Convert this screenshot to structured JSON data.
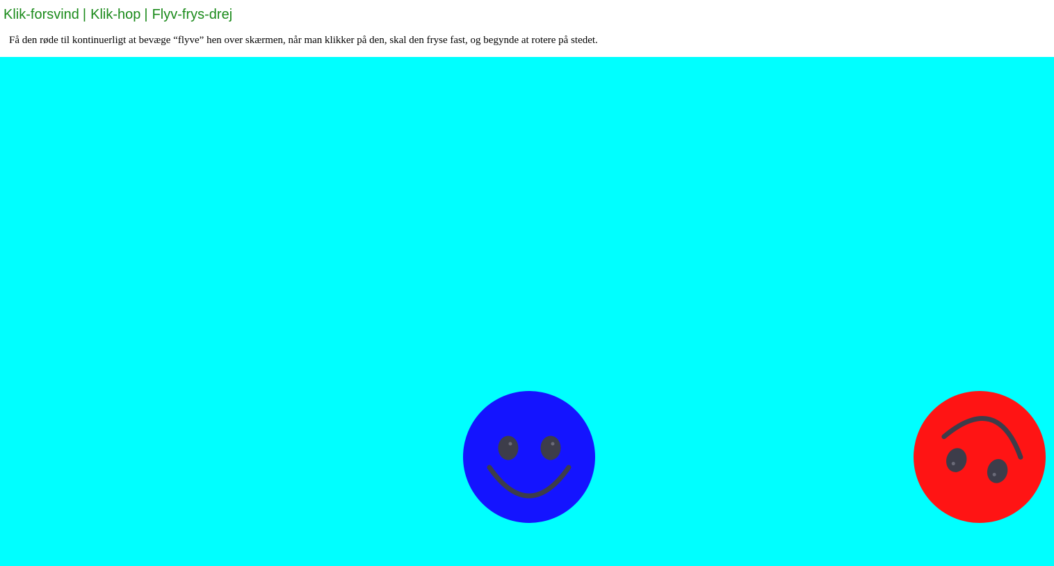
{
  "nav": {
    "links": [
      "Klik-forsvind",
      "Klik-hop",
      "Flyv-frys-drej"
    ],
    "separator": "|"
  },
  "description": "Få den røde til kontinuerligt at bevæge “flyve” hen over skærmen, når man klikker på den, skal den fryse fast, og begynde at rotere på stedet.",
  "colors": {
    "stage_background": "#00ffff",
    "nav_link": "#1a8a1a",
    "blue_smiley": "#1414ff",
    "red_smiley": "#ff1414",
    "smiley_features": "#3d3d4a"
  },
  "stage": {
    "smileys": [
      {
        "name": "blue-smiley",
        "color": "#1414ff",
        "rotation_deg": 0
      },
      {
        "name": "red-smiley",
        "color": "#ff1414",
        "rotation_deg": 195
      }
    ]
  }
}
